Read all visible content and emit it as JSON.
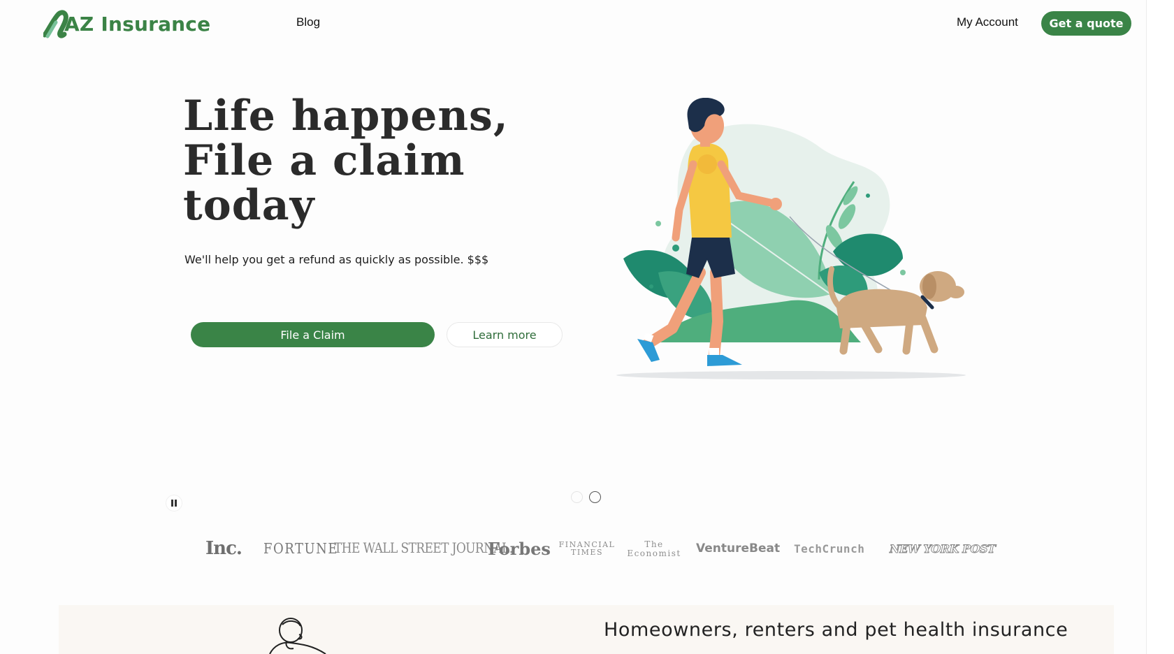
{
  "header": {
    "logo_text": "AZ Insurance",
    "nav_blog": "Blog",
    "nav_account": "My Account",
    "quote_button": "Get a quote"
  },
  "hero": {
    "title_lines": [
      "Life happens,",
      "File a claim",
      "today"
    ],
    "subtitle": "We'll help you get a refund as quickly as possible. $$$",
    "primary_button": "File a Claim",
    "secondary_button": "Learn more",
    "illustration": "person-walking-dog-illustration"
  },
  "carousel": {
    "slide_count": 2,
    "active_slide": 2,
    "pause_icon": "pause-icon"
  },
  "press": {
    "inc": "Inc.",
    "fortune": "FORTUNE",
    "wsj": "THE WALL STREET JOURNAL.",
    "forbes": "Forbes",
    "ft": "FINANCIAL TIMES",
    "economist": "The Economist",
    "venturebeat": "VentureBeat",
    "techcrunch": "TechCrunch",
    "nypost": "NEW YORK POST"
  },
  "section": {
    "heading": "Homeowners, renters and pet health insurance"
  },
  "colors": {
    "brand_green": "#3a8447",
    "logo_green": "#3b8346",
    "leaf_green": "#4fae7d",
    "shirt_yellow": "#f5c842",
    "dog_tan": "#cfa981",
    "band_beige": "#faf7f3"
  }
}
